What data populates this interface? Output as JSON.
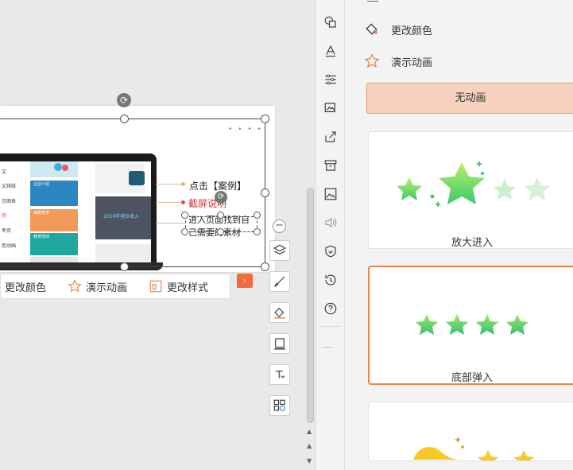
{
  "callouts": {
    "case": "点击【案例】",
    "screenshot": "截屏说明",
    "find_line1": "进入页面找到自",
    "find_line2": "己需要的素材"
  },
  "screen": {
    "sidebar_items": [
      "文",
      "文排版",
      "示图表",
      "例",
      "率页",
      "色动画"
    ],
    "thumb_labels": [
      "企业介绍",
      "海报宣传",
      "教育培训"
    ],
    "revenue_banner": "2018年营业收入"
  },
  "context_bar": {
    "change_color": "更改颜色",
    "demo_animation": "演示动画",
    "change_style": "更改样式",
    "next": "›"
  },
  "panel": {
    "menu": [
      {
        "label": "更改颜色",
        "icon": "paint-bucket-icon"
      },
      {
        "label": "演示动画",
        "icon": "star-outline-icon"
      }
    ],
    "no_animation": "无动画",
    "cards": [
      {
        "label": "放大进入",
        "selected": false
      },
      {
        "label": "底部弹入",
        "selected": true
      }
    ]
  },
  "colors": {
    "accent": "#e8834d",
    "star_green": "#5fd16a",
    "star_yellow": "#f7c928",
    "no_anim_bg": "#f6d1bd"
  }
}
